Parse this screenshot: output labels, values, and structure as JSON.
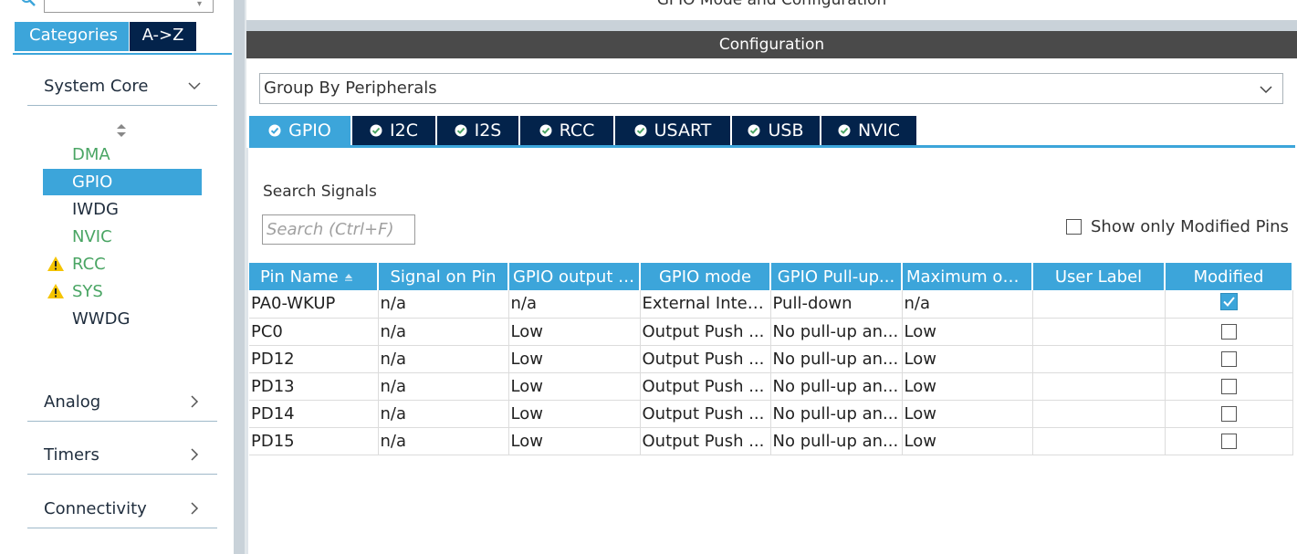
{
  "window": {
    "panel_title": "GPIO Mode and Configuration",
    "configuration_label": "Configuration"
  },
  "sidebar": {
    "tabs": [
      {
        "label": "Categories",
        "active": true
      },
      {
        "label": "A->Z",
        "active": false
      }
    ],
    "categories": [
      {
        "label": "System Core",
        "expanded": true
      },
      {
        "label": "Analog",
        "expanded": false
      },
      {
        "label": "Timers",
        "expanded": false
      },
      {
        "label": "Connectivity",
        "expanded": false
      }
    ],
    "system_core_items": [
      {
        "label": "DMA",
        "status": "configured",
        "warning": false
      },
      {
        "label": "GPIO",
        "status": "selected",
        "warning": false
      },
      {
        "label": "IWDG",
        "status": "normal",
        "warning": false
      },
      {
        "label": "NVIC",
        "status": "configured",
        "warning": false
      },
      {
        "label": "RCC",
        "status": "configured",
        "warning": true
      },
      {
        "label": "SYS",
        "status": "configured",
        "warning": true
      },
      {
        "label": "WWDG",
        "status": "normal",
        "warning": false
      }
    ]
  },
  "config": {
    "group_by": "Group By Peripherals",
    "tabs": [
      {
        "label": "GPIO",
        "active": true
      },
      {
        "label": "I2C",
        "active": false
      },
      {
        "label": "I2S",
        "active": false
      },
      {
        "label": "RCC",
        "active": false
      },
      {
        "label": "USART",
        "active": false
      },
      {
        "label": "USB",
        "active": false
      },
      {
        "label": "NVIC",
        "active": false
      }
    ],
    "search_label": "Search Signals",
    "search_placeholder": "Search (Ctrl+F)",
    "show_modified_label": "Show only Modified Pins",
    "show_modified_checked": false
  },
  "table": {
    "columns": [
      "Pin Name",
      "Signal on Pin",
      "GPIO output l...",
      "GPIO mode",
      "GPIO Pull-up...",
      "Maximum out...",
      "User Label",
      "Modified"
    ],
    "rows": [
      {
        "pin": "PA0-WKUP",
        "signal": "n/a",
        "output": "n/a",
        "mode": "External Inter...",
        "pull": "Pull-down",
        "speed": "n/a",
        "label": "",
        "modified": true
      },
      {
        "pin": "PC0",
        "signal": "n/a",
        "output": "Low",
        "mode": "Output Push ...",
        "pull": "No pull-up an...",
        "speed": "Low",
        "label": "",
        "modified": false
      },
      {
        "pin": "PD12",
        "signal": "n/a",
        "output": "Low",
        "mode": "Output Push ...",
        "pull": "No pull-up an...",
        "speed": "Low",
        "label": "",
        "modified": false
      },
      {
        "pin": "PD13",
        "signal": "n/a",
        "output": "Low",
        "mode": "Output Push ...",
        "pull": "No pull-up an...",
        "speed": "Low",
        "label": "",
        "modified": false
      },
      {
        "pin": "PD14",
        "signal": "n/a",
        "output": "Low",
        "mode": "Output Push ...",
        "pull": "No pull-up an...",
        "speed": "Low",
        "label": "",
        "modified": false
      },
      {
        "pin": "PD15",
        "signal": "n/a",
        "output": "Low",
        "mode": "Output Push ...",
        "pull": "No pull-up an...",
        "speed": "Low",
        "label": "",
        "modified": false
      }
    ]
  },
  "colors": {
    "accent": "#3ca5da",
    "dark_tab": "#03234b",
    "configured_green": "#4aa564",
    "warning_yellow": "#f5c400",
    "header_bar": "#4a4a4a"
  }
}
